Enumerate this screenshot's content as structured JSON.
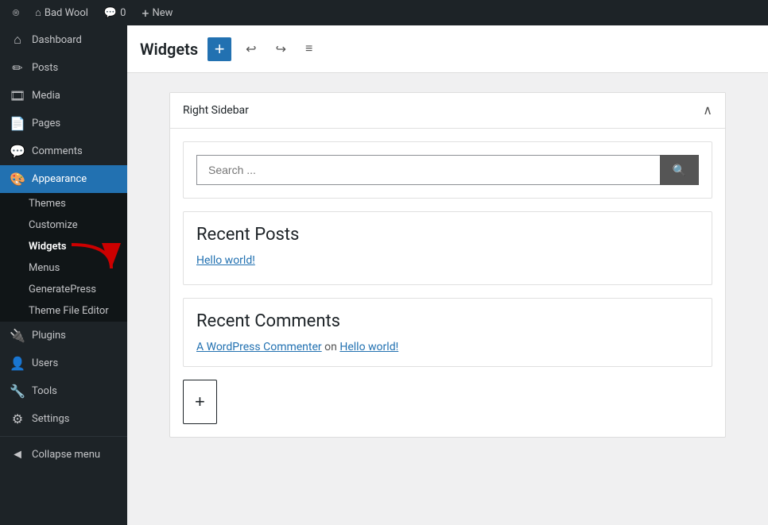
{
  "adminbar": {
    "logo": "⊞",
    "site_name": "Bad Wool",
    "comments_label": "Comments",
    "comments_count": "0",
    "new_label": "New",
    "new_icon": "+"
  },
  "sidebar": {
    "menu_items": [
      {
        "id": "dashboard",
        "icon": "⌂",
        "label": "Dashboard"
      },
      {
        "id": "posts",
        "icon": "📝",
        "label": "Posts"
      },
      {
        "id": "media",
        "icon": "🎞",
        "label": "Media"
      },
      {
        "id": "pages",
        "icon": "📄",
        "label": "Pages"
      },
      {
        "id": "comments",
        "icon": "💬",
        "label": "Comments"
      },
      {
        "id": "appearance",
        "icon": "🎨",
        "label": "Appearance",
        "active": true
      },
      {
        "id": "plugins",
        "icon": "🔌",
        "label": "Plugins"
      },
      {
        "id": "users",
        "icon": "👤",
        "label": "Users"
      },
      {
        "id": "tools",
        "icon": "🔧",
        "label": "Tools"
      },
      {
        "id": "settings",
        "icon": "⚙",
        "label": "Settings"
      }
    ],
    "appearance_submenu": [
      {
        "id": "themes",
        "label": "Themes"
      },
      {
        "id": "customize",
        "label": "Customize"
      },
      {
        "id": "widgets",
        "label": "Widgets",
        "active": true
      },
      {
        "id": "menus",
        "label": "Menus"
      },
      {
        "id": "generatepress",
        "label": "GeneratePress"
      },
      {
        "id": "theme-file-editor",
        "label": "Theme File Editor"
      }
    ],
    "collapse_label": "Collapse menu",
    "collapse_icon": "◄"
  },
  "header": {
    "title": "Widgets",
    "add_button_label": "+",
    "undo_icon": "↩",
    "redo_icon": "↪",
    "list_icon": "≡"
  },
  "widget_area": {
    "title": "Right Sidebar",
    "collapse_icon": "∧",
    "search_widget": {
      "placeholder": "Search ...",
      "button_icon": "🔍"
    },
    "recent_posts": {
      "title": "Recent Posts",
      "posts": [
        {
          "label": "Hello world!"
        }
      ]
    },
    "recent_comments": {
      "title": "Recent Comments",
      "comment_author": "A WordPress Commenter",
      "comment_on": "on",
      "comment_post": "Hello world!"
    },
    "add_block_icon": "+"
  }
}
